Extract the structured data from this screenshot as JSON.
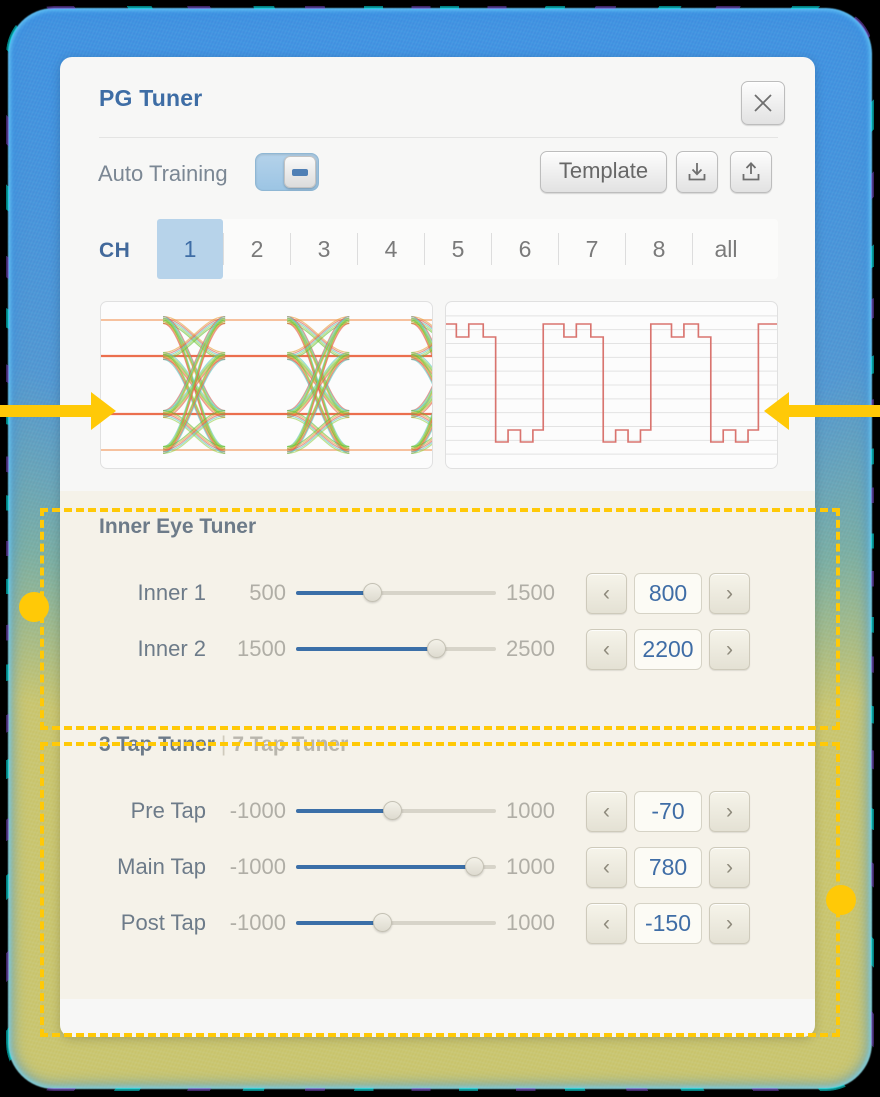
{
  "window": {
    "title": "PG Tuner",
    "close_icon": "close-icon"
  },
  "toolbar": {
    "auto_training_label": "Auto Training",
    "auto_training_on": true,
    "template_label": "Template",
    "download_icon": "download-icon",
    "upload_icon": "upload-icon"
  },
  "channels": {
    "label": "CH",
    "selected": "1",
    "tabs": [
      "1",
      "2",
      "3",
      "4",
      "5",
      "6",
      "7",
      "8",
      "all"
    ]
  },
  "plots": {
    "eye_diagram_name": "eye-diagram",
    "waveform_name": "waveform-plot",
    "eye_color_a": "#67c23a",
    "eye_color_b": "#e6a23c",
    "eye_color_c": "#e05a4f",
    "waveform_color": "#d9746f"
  },
  "inner_eye": {
    "title": "Inner Eye Tuner",
    "rows": [
      {
        "label": "Inner 1",
        "min": "500",
        "max": "1500",
        "value": "800",
        "pct": 38
      },
      {
        "label": "Inner 2",
        "min": "1500",
        "max": "2500",
        "value": "2200",
        "pct": 70
      }
    ]
  },
  "tap_tuner": {
    "title_active": "3 Tap Tuner",
    "title_separator": "|",
    "title_inactive": "7 Tap Tuner",
    "rows": [
      {
        "label": "Pre Tap",
        "min": "-1000",
        "max": "1000",
        "value": "-70",
        "pct": 48
      },
      {
        "label": "Main Tap",
        "min": "-1000",
        "max": "1000",
        "value": "780",
        "pct": 89
      },
      {
        "label": "Post Tap",
        "min": "-1000",
        "max": "1000",
        "value": "-150",
        "pct": 43
      }
    ]
  },
  "stepper": {
    "dec_icon": "chevron-left-icon",
    "inc_icon": "chevron-right-icon",
    "dec_glyph": "‹",
    "inc_glyph": "›"
  },
  "annotations": {
    "accent": "#ffc907",
    "arrow_left_name": "annotation-arrow-pointing-to-eye-diagram",
    "arrow_right_name": "annotation-arrow-pointing-to-waveform",
    "box_inner_eye_name": "annotation-box-inner-eye-tuner",
    "box_tap_name": "annotation-box-tap-tuner"
  }
}
